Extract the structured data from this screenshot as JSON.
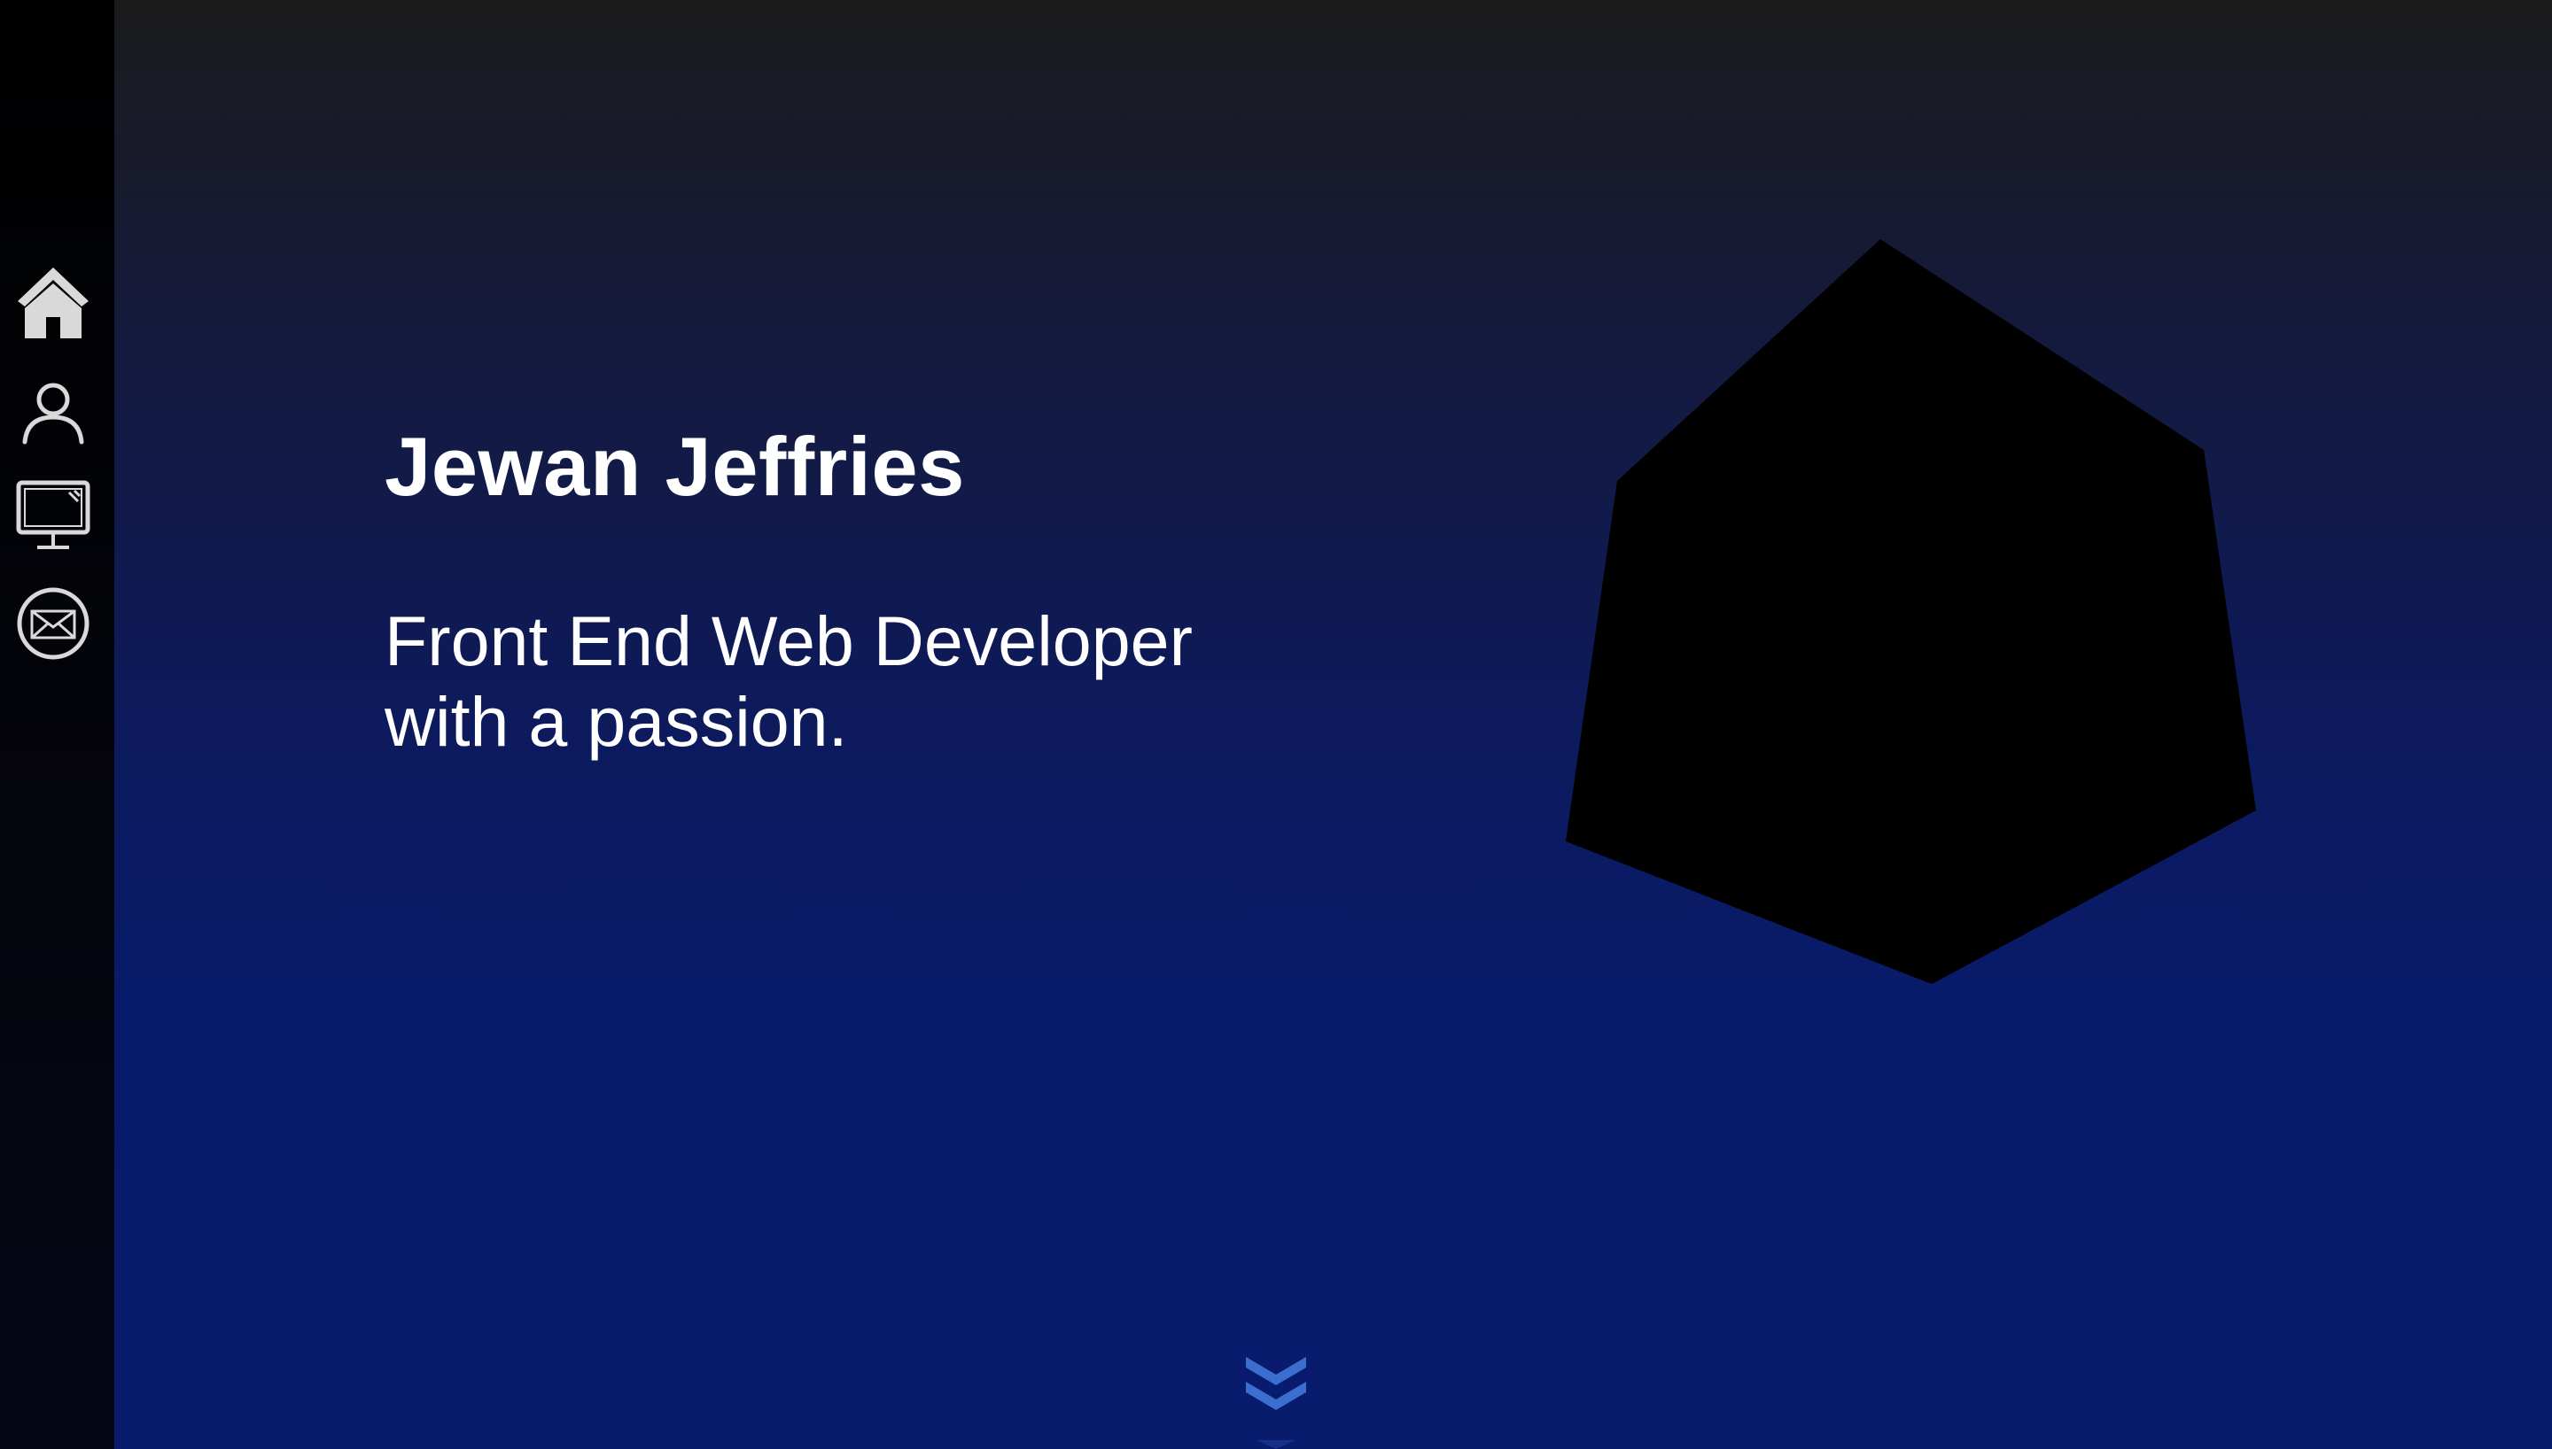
{
  "nav": {
    "items": [
      {
        "icon": "home-icon"
      },
      {
        "icon": "user-icon"
      },
      {
        "icon": "monitor-icon"
      },
      {
        "icon": "mail-icon"
      }
    ]
  },
  "hero": {
    "name": "Jewan Jeffries",
    "tagline": "Front End Web Developer with a passion."
  },
  "colors": {
    "background_top": "#1b1b1c",
    "background_bottom": "#081b6c",
    "sidebar": "#000000",
    "nav_icon": "#d9d9d9",
    "text": "#ffffff",
    "shape": "#000000",
    "scroll_arrow": "#3a6fd0"
  },
  "scroll": {
    "icon": "double-chevron-down-icon"
  }
}
